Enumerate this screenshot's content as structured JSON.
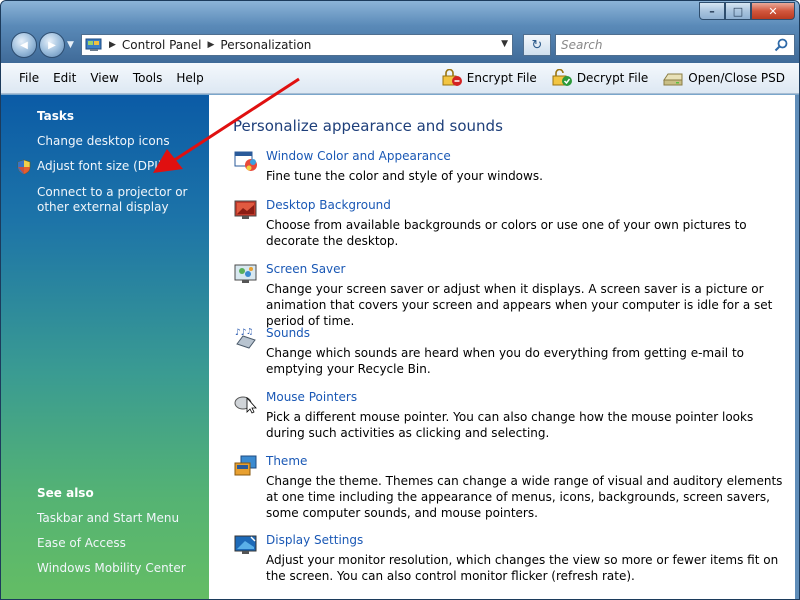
{
  "window": {
    "minimize_glyph": "–",
    "maximize_glyph": "□",
    "close_glyph": "✕"
  },
  "nav": {
    "back_glyph": "◀",
    "forward_glyph": "▶",
    "dropdown_glyph": "▼"
  },
  "address": {
    "crumbs": [
      "Control Panel",
      "Personalization"
    ],
    "sep_glyph": "▶",
    "dropdown_glyph": "▼"
  },
  "refresh_glyph": "↻",
  "search": {
    "placeholder": "Search"
  },
  "menu": [
    "File",
    "Edit",
    "View",
    "Tools",
    "Help"
  ],
  "commands": [
    "Encrypt File",
    "Decrypt File",
    "Open/Close PSD"
  ],
  "left_pane": {
    "tasks_heading": "Tasks",
    "tasks": [
      "Change desktop icons",
      "Adjust font size (DPI)",
      "Connect to a projector or other external display"
    ],
    "see_also_heading": "See also",
    "see_also": [
      "Taskbar and Start Menu",
      "Ease of Access",
      "Windows Mobility Center"
    ]
  },
  "content": {
    "title": "Personalize appearance and sounds",
    "items": [
      {
        "title": "Window Color and Appearance",
        "desc": "Fine tune the color and style of your windows.",
        "icon": "window-color-icon"
      },
      {
        "title": "Desktop Background",
        "desc": "Choose from available backgrounds or colors or use one of your own pictures to decorate the desktop.",
        "icon": "desktop-background-icon"
      },
      {
        "title": "Screen Saver",
        "desc": "Change your screen saver or adjust when it displays. A screen saver is a picture or animation that covers your screen and appears when your computer is idle for a set period of time.",
        "icon": "screen-saver-icon"
      },
      {
        "title": "Sounds",
        "desc": "Change which sounds are heard when you do everything from getting e-mail to emptying your Recycle Bin.",
        "icon": "sounds-icon"
      },
      {
        "title": "Mouse Pointers",
        "desc": "Pick a different mouse pointer. You can also change how the mouse pointer looks during such activities as clicking and selecting.",
        "icon": "mouse-pointer-icon"
      },
      {
        "title": "Theme",
        "desc": "Change the theme. Themes can change a wide range of visual and auditory elements at one time including the appearance of menus, icons, backgrounds, screen savers, some computer sounds, and mouse pointers.",
        "icon": "theme-icon"
      },
      {
        "title": "Display Settings",
        "desc": "Adjust your monitor resolution, which changes the view so more or fewer items fit on the screen. You can also control monitor flicker (refresh rate).",
        "icon": "display-settings-icon"
      }
    ]
  },
  "colors": {
    "link": "#1a58b5",
    "heading": "#1e3f7a",
    "arrow": "#e01010"
  }
}
